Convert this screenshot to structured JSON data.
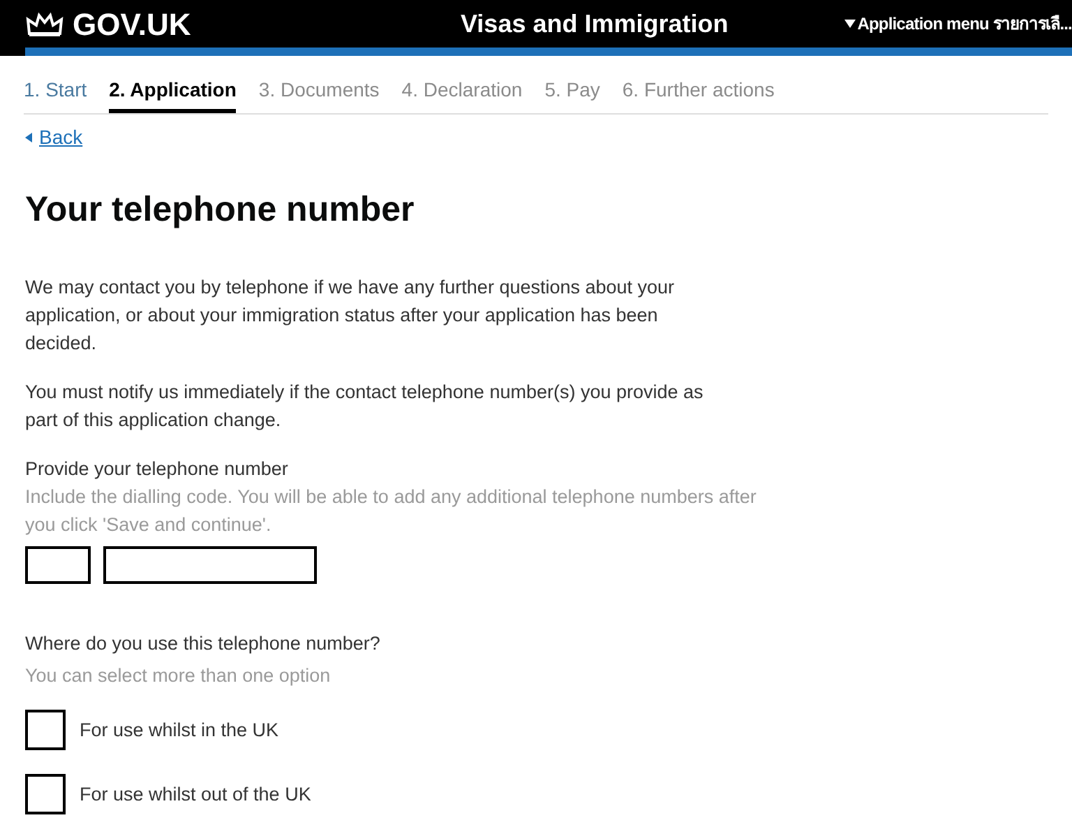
{
  "header": {
    "logo": "GOV.UK",
    "service": "Visas and Immigration",
    "menu": "Application menu รายการเลื..."
  },
  "steps": [
    {
      "label": "1. Start",
      "selected": false,
      "done": true
    },
    {
      "label": "2. Application",
      "selected": true,
      "done": false
    },
    {
      "label": "3. Documents",
      "selected": false,
      "done": false
    },
    {
      "label": "4. Declaration",
      "selected": false,
      "done": false
    },
    {
      "label": "5. Pay",
      "selected": false,
      "done": false
    },
    {
      "label": "6. Further actions",
      "selected": false,
      "done": false
    }
  ],
  "back": "Back",
  "title": "Your telephone number",
  "paragraphs": [
    "We may contact you by telephone if we have any further questions about your application, or about your immigration status after your application has been decided.",
    "You must notify us immediately if the contact telephone number(s) you provide as part of this application change."
  ],
  "phone": {
    "label": "Provide your telephone number",
    "hint": "Include the dialling code. You will be able to add any additional telephone numbers after you click 'Save and continue'."
  },
  "usage": {
    "label": "Where do you use this telephone number?",
    "hint": "You can select more than one option",
    "options": [
      {
        "label": "For use whilst in the UK",
        "checked": false
      },
      {
        "label": "For use whilst out of the UK",
        "checked": false
      }
    ]
  }
}
